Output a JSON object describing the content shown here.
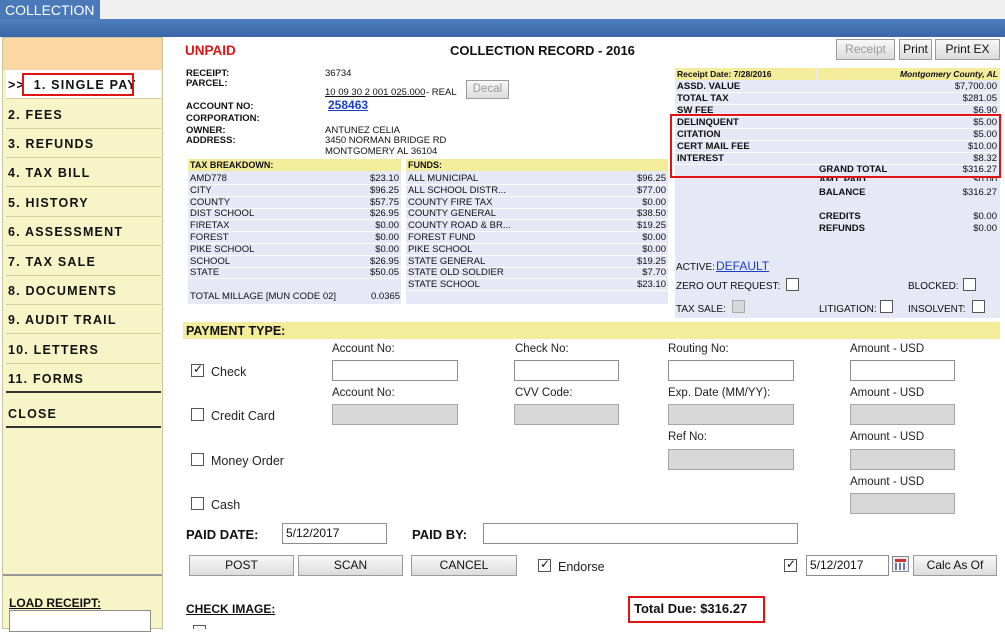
{
  "app": {
    "tab_label": "COLLECTION"
  },
  "sidebar": {
    "prefix": ">>",
    "items": [
      {
        "label": "1. SINGLE PAY"
      },
      {
        "label": "2. FEES"
      },
      {
        "label": "3. REFUNDS"
      },
      {
        "label": "4. TAX BILL"
      },
      {
        "label": "5. HISTORY"
      },
      {
        "label": "6. ASSESSMENT"
      },
      {
        "label": "7. TAX SALE"
      },
      {
        "label": "8. DOCUMENTS"
      },
      {
        "label": "9. AUDIT TRAIL"
      },
      {
        "label": "10. LETTERS"
      },
      {
        "label": "11. FORMS"
      }
    ],
    "close_label": "CLOSE",
    "load_receipt_label": "LOAD RECEIPT:"
  },
  "record": {
    "status": "UNPAID",
    "title": "COLLECTION RECORD - 2016",
    "buttons": {
      "receipt": "Receipt",
      "print": "Print",
      "print_ex": "Print EX"
    },
    "receipt_label": "RECEIPT:",
    "receipt_value": "36734",
    "parcel_label": "PARCEL:",
    "parcel_value": "10 09 30 2 001 025.000",
    "parcel_type": "- REAL",
    "decal_label": "Decal",
    "account_label": "ACCOUNT NO:",
    "account_value": "258463",
    "corporation_label": "CORPORATION:",
    "owner_label": "OWNER:",
    "owner_value": "ANTUNEZ CELIA",
    "address_label": "ADDRESS:",
    "address_line1": "3450 NORMAN BRIDGE RD",
    "address_line2": "MONTGOMERY AL  36104"
  },
  "tax_breakdown": {
    "header": "TAX BREAKDOWN:",
    "rows": [
      {
        "name": "AMD778",
        "amount": "$23.10"
      },
      {
        "name": "CITY",
        "amount": "$96.25"
      },
      {
        "name": "COUNTY",
        "amount": "$57.75"
      },
      {
        "name": "DIST SCHOOL",
        "amount": "$26.95"
      },
      {
        "name": "FIRETAX",
        "amount": "$0.00"
      },
      {
        "name": "FOREST",
        "amount": "$0.00"
      },
      {
        "name": "PIKE SCHOOL",
        "amount": "$0.00"
      },
      {
        "name": "SCHOOL",
        "amount": "$26.95"
      },
      {
        "name": "STATE",
        "amount": "$50.05"
      }
    ],
    "millage_label": "TOTAL MILLAGE [MUN CODE 02]",
    "millage_value": "0.0365"
  },
  "funds": {
    "header": "FUNDS:",
    "rows": [
      {
        "name": "ALL MUNICIPAL",
        "amount": "$96.25"
      },
      {
        "name": "ALL SCHOOL DISTR...",
        "amount": "$77.00"
      },
      {
        "name": "COUNTY FIRE TAX",
        "amount": "$0.00"
      },
      {
        "name": "COUNTY GENERAL",
        "amount": "$38.50"
      },
      {
        "name": "COUNTY ROAD & BR...",
        "amount": "$19.25"
      },
      {
        "name": "FOREST FUND",
        "amount": "$0.00"
      },
      {
        "name": "PIKE SCHOOL",
        "amount": "$0.00"
      },
      {
        "name": "STATE GENERAL",
        "amount": "$19.25"
      },
      {
        "name": "STATE OLD SOLDIER",
        "amount": "$7.70"
      },
      {
        "name": "STATE SCHOOL",
        "amount": "$23.10"
      }
    ]
  },
  "summary": {
    "receipt_date": "Receipt Date: 7/28/2016",
    "county": "Montgomery County, AL",
    "rows": [
      {
        "name": "ASSD. VALUE",
        "amount": "$7,700.00"
      },
      {
        "name": "TOTAL TAX",
        "amount": "$281.05"
      },
      {
        "name": "SW FEE",
        "amount": "$6.90"
      },
      {
        "name": "DELINQUENT",
        "amount": "$5.00"
      },
      {
        "name": "CITATION",
        "amount": "$5.00"
      },
      {
        "name": "CERT MAIL FEE",
        "amount": "$10.00"
      },
      {
        "name": "INTEREST",
        "amount": "$8.32"
      }
    ],
    "grand_total_label": "GRAND TOTAL",
    "grand_total": "$316.27",
    "amt_paid_label": "AMT. PAID",
    "amt_paid": "$0.00",
    "balance_label": "BALANCE",
    "balance": "$316.27",
    "credits_label": "CREDITS",
    "credits": "$0.00",
    "refunds_label": "REFUNDS",
    "refunds": "$0.00",
    "active_label": "ACTIVE:",
    "active_value": "DEFAULT",
    "zero_out_label": "ZERO OUT REQUEST:",
    "blocked_label": "BLOCKED:",
    "tax_sale_label": "TAX SALE:",
    "litigation_label": "LITIGATION:",
    "insolvent_label": "INSOLVENT:"
  },
  "payment": {
    "header": "PAYMENT TYPE:",
    "check_label": "Check",
    "credit_card_label": "Credit Card",
    "money_order_label": "Money Order",
    "cash_label": "Cash",
    "account_no_label": "Account No:",
    "check_no_label": "Check No:",
    "routing_no_label": "Routing No:",
    "amount_usd_label": "Amount - USD",
    "cvv_label": "CVV Code:",
    "exp_label": "Exp. Date (MM/YY):",
    "ref_label": "Ref No:",
    "paid_date_label": "PAID DATE:",
    "paid_date_value": "5/12/2017",
    "paid_by_label": "PAID BY:",
    "paid_by_value": "",
    "post_label": "POST",
    "scan_label": "SCAN",
    "cancel_label": "CANCEL",
    "endorse_label": "Endorse",
    "calc_date_value": "5/12/2017",
    "calc_label": "Calc As Of",
    "check_image_label": "CHECK IMAGE:",
    "total_due": "Total Due: $316.27"
  }
}
